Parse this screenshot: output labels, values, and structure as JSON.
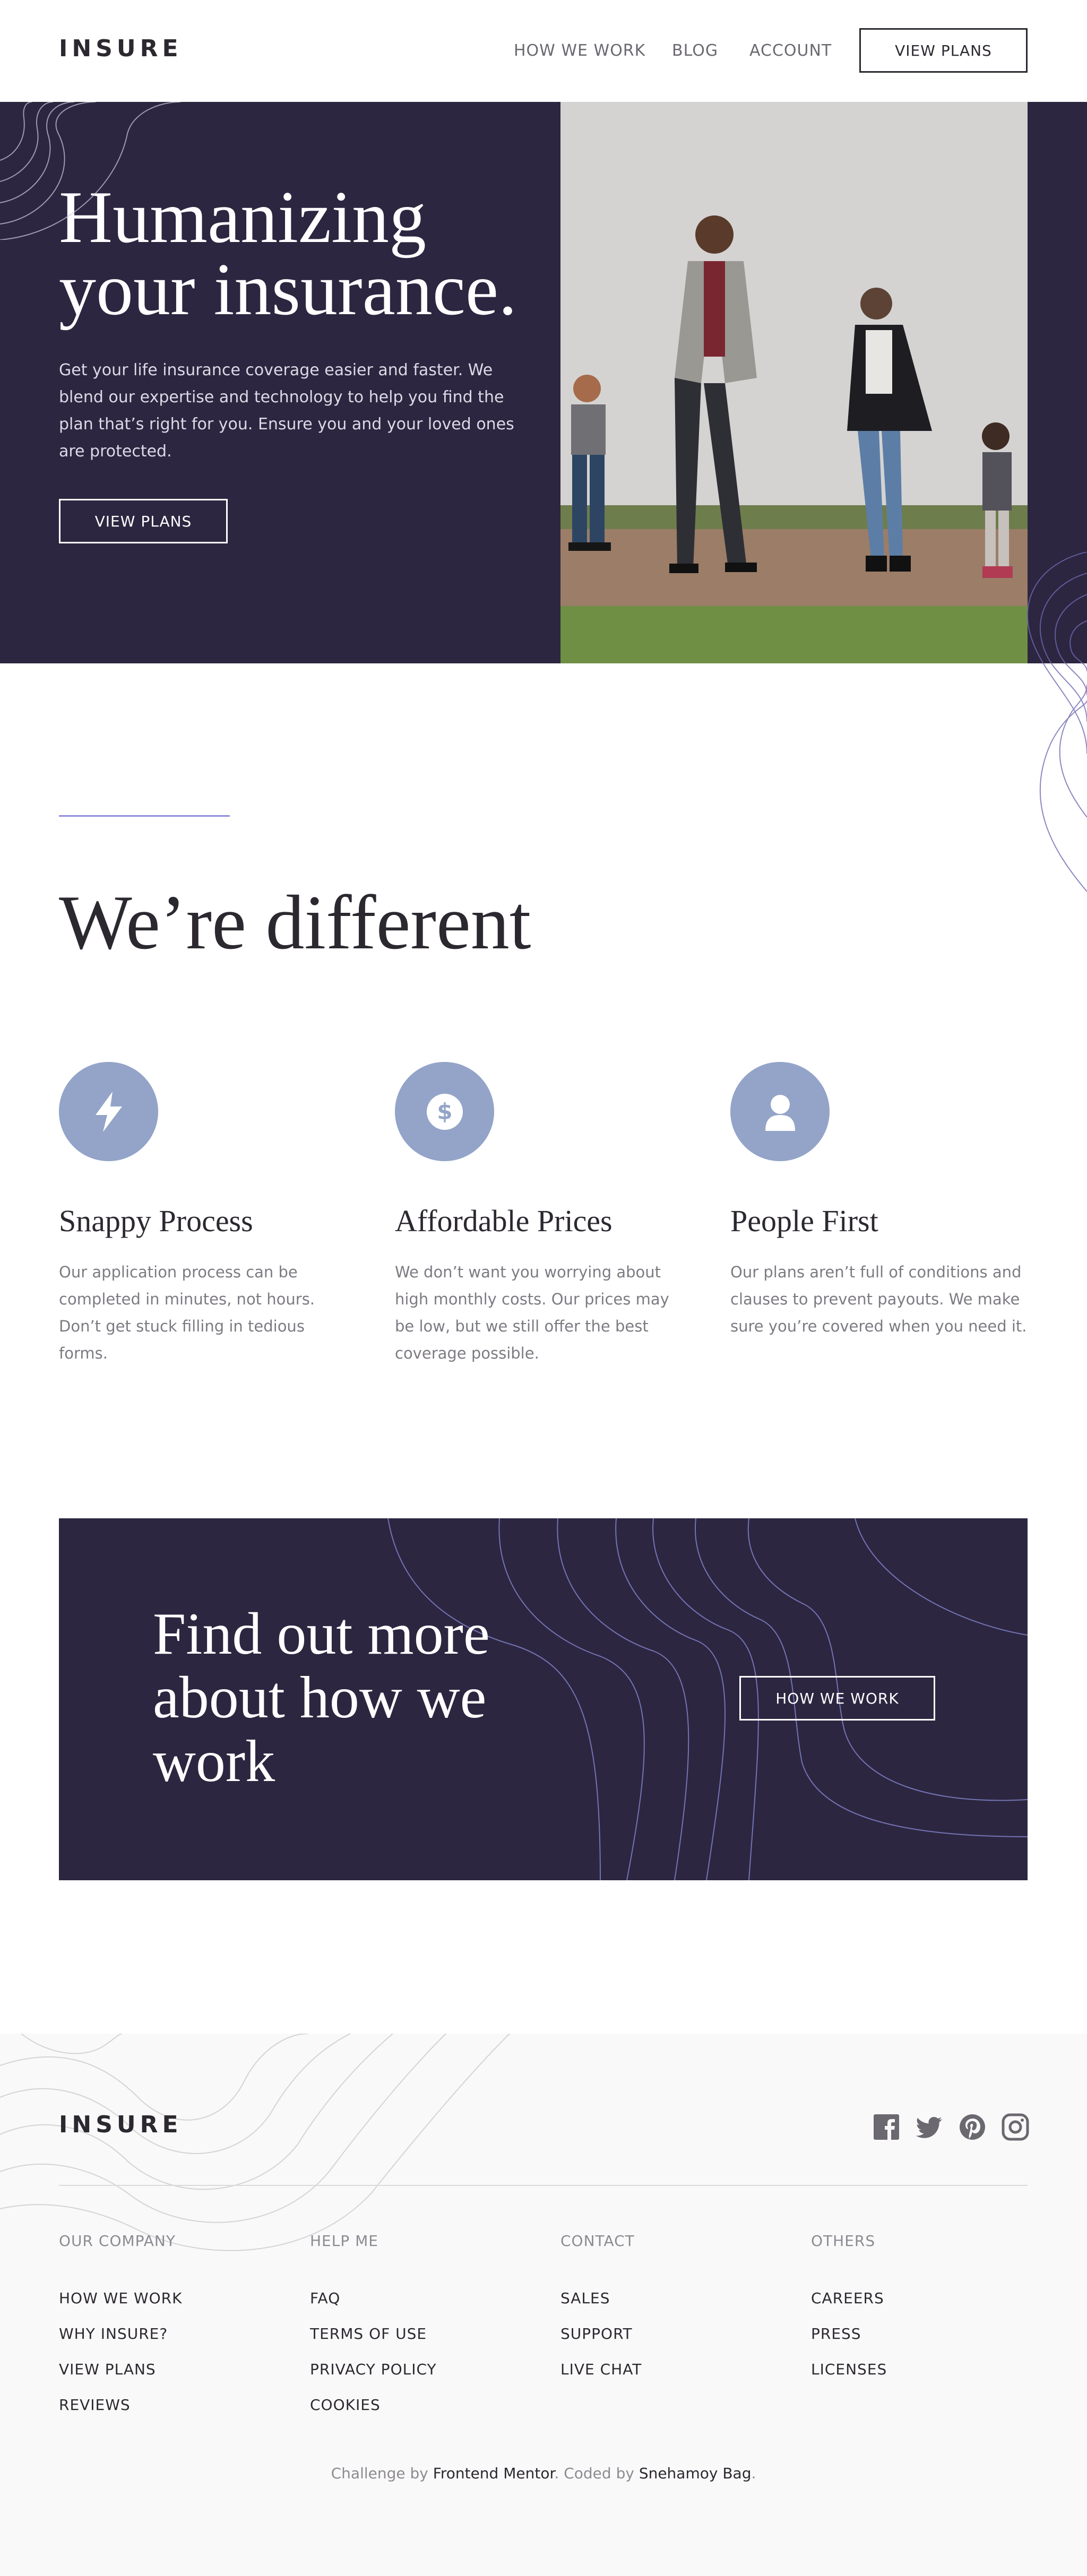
{
  "header": {
    "logo": "INSURE",
    "nav": [
      "HOW WE WORK",
      "BLOG",
      "ACCOUNT"
    ],
    "cta": "VIEW PLANS"
  },
  "hero": {
    "title_line1": "Humanizing",
    "title_line2": "your insurance.",
    "text": "Get your life insurance coverage easier and faster. We blend our expertise and technology to help you find the plan that’s right for you. Ensure you and your loved ones are protected.",
    "button": "VIEW PLANS"
  },
  "different": {
    "title": "We’re different",
    "features": [
      {
        "icon": "lightning-icon",
        "title": "Snappy Process",
        "text": "Our application process can be completed in minutes, not hours. Don’t get stuck filling in tedious forms."
      },
      {
        "icon": "dollar-icon",
        "title": "Affordable Prices",
        "text": "We don’t want you worrying about high monthly costs. Our prices may be low, but we still offer the best coverage possible."
      },
      {
        "icon": "person-icon",
        "title": "People First",
        "text": "Our plans aren’t full of conditions and clauses to prevent payouts. We make sure you’re covered when you need it."
      }
    ]
  },
  "cta": {
    "title": "Find out more about how we work",
    "button": "HOW WE WORK"
  },
  "footer": {
    "logo": "INSURE",
    "social": [
      "facebook-icon",
      "twitter-icon",
      "pinterest-icon",
      "instagram-icon"
    ],
    "columns": [
      {
        "heading": "OUR COMPANY",
        "links": [
          "HOW WE WORK",
          "WHY INSURE?",
          "VIEW PLANS",
          "REVIEWS"
        ]
      },
      {
        "heading": "HELP ME",
        "links": [
          "FAQ",
          "TERMS OF USE",
          "PRIVACY POLICY",
          "COOKIES"
        ]
      },
      {
        "heading": "CONTACT",
        "links": [
          "SALES",
          "SUPPORT",
          "LIVE CHAT"
        ]
      },
      {
        "heading": "OTHERS",
        "links": [
          "CAREERS",
          "PRESS",
          "LICENSES"
        ]
      }
    ],
    "attribution": {
      "prefix": "Challenge by ",
      "mentor": "Frontend Mentor",
      "middle": ". Coded by ",
      "author": "Snehamoy Bag",
      "suffix": "."
    }
  },
  "colors": {
    "dark_violet": "#2c2640",
    "grayish_blue": "#93a4c8",
    "accent_line": "#8c8edc"
  }
}
